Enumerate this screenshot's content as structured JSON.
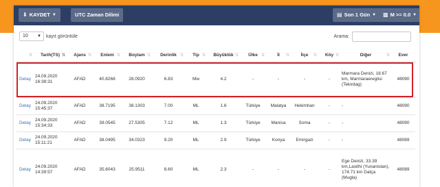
{
  "toolbar": {
    "save_label": "KAYDET",
    "utc_label": "UTC Zaman Dilimi",
    "last_label": "Son 1 Gün",
    "magnitude_label": "M >= 0.0"
  },
  "controls": {
    "length_value": "10",
    "length_suffix": "kayıt görüntüle",
    "search_label": "Arama:"
  },
  "table": {
    "columns": [
      "",
      "Tarih(TS)",
      "Ajans",
      "Enlem",
      "Boylam",
      "Derinlik",
      "Tip",
      "Büyüklük",
      "Ülke",
      "İl",
      "İlçe",
      "Köy",
      "Diğer",
      "Ever"
    ],
    "rows": [
      [
        "Detay",
        "24.09.2020 16:38:31",
        "AFAD",
        "40.8268",
        "28.0920",
        "6.83",
        "Mw",
        "4.2",
        "-",
        "-",
        "-",
        "-",
        "Marmara Denizi, 18.67 km, Marmaraereglisi (Tekirdag)",
        "48090"
      ],
      [
        "Detay",
        "24.09.2020 15:45:37",
        "AFAD",
        "38.7195",
        "38.1303",
        "7.00",
        "ML",
        "1.6",
        "Türkiye",
        "Malatya",
        "Hekimhan",
        "-",
        "-",
        "48090"
      ],
      [
        "Detay",
        "24.09.2020 15:34:33",
        "AFAD",
        "39.0545",
        "27.5305",
        "7.12",
        "ML",
        "1.3",
        "Türkiye",
        "Manisa",
        "Soma",
        "-",
        "-",
        "48090"
      ],
      [
        "Detay",
        "24.09.2020 15:11:21",
        "AFAD",
        "38.0495",
        "34.0323",
        "9.20",
        "ML",
        "2.9",
        "Türkiye",
        "Konya",
        "Emirgazi",
        "-",
        "-",
        "48089"
      ],
      [
        "Detay",
        "24.09.2020 14:39:57",
        "AFAD",
        "35.6043",
        "25.9511",
        "8.60",
        "ML",
        "2.3",
        "-",
        "-",
        "-",
        "-",
        "Ege Denizi, 33.39 km,Lasithi (Yunanistan), 174.71 km Datça (Mugla)",
        "48089"
      ]
    ]
  },
  "colors": {
    "brand_orange": "#f7961e",
    "toolbar_navy": "#2c3e63",
    "highlight_red": "#d32026",
    "link_blue": "#3a71b8"
  }
}
